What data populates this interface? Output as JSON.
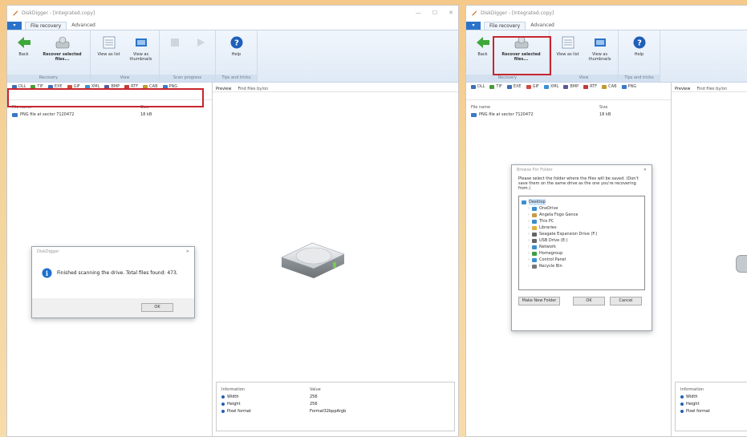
{
  "app": {
    "title": "DiskDigger - [Integrated.copy]",
    "file_menu_label": "",
    "tabs": [
      "File recovery",
      "Advanced"
    ],
    "window_controls": [
      "—",
      "☐",
      "✕"
    ]
  },
  "ribbon": {
    "back_label": "Back",
    "recover_label": "Recover selected files...",
    "view_list_label": "View as list",
    "view_thumbs_label": "View as thumbnails",
    "stop_label": "",
    "resume_label": "",
    "help_label": "Help",
    "groups": [
      "Recovery",
      "View",
      "Scan progress",
      "Tips and tricks"
    ]
  },
  "filters": [
    "DLL",
    "TIF",
    "EXE",
    "GIF",
    "XML",
    "BMP",
    "RTF",
    "CAB",
    "PNG"
  ],
  "filter_colors": [
    "#3c6fb5",
    "#4a9a3c",
    "#3c6fb5",
    "#d24a3a",
    "#3b8fd0",
    "#5a5a9a",
    "#c23a3a",
    "#c29a2a",
    "#3b78c8"
  ],
  "file_list": {
    "col_name": "File name",
    "col_size": "Size",
    "rows": [
      {
        "name": "PNG file at sector 7120472",
        "size": "18 kB"
      }
    ]
  },
  "preview_tabs": [
    "Preview",
    "Find files by/on"
  ],
  "info": {
    "col_info": "Information",
    "col_value": "Value",
    "rows": [
      {
        "k": "Width",
        "v": "256"
      },
      {
        "k": "Height",
        "v": "256"
      },
      {
        "k": "Pixel format",
        "v": "Format32bppArgb"
      }
    ]
  },
  "scan_dialog": {
    "title": "DiskDigger",
    "message": "Finished scanning the drive. Total files found: 473.",
    "ok_label": "OK"
  },
  "folder_dialog": {
    "title": "Browse For Folder",
    "message": "Please select the folder where the files will be saved. (Don't save them on the same drive as the one you're recovering from.)",
    "tree": [
      {
        "label": "Desktop",
        "icon": "desktop-icon",
        "color": "#3b8fd0",
        "indent": 0,
        "selected": true
      },
      {
        "label": "OneDrive",
        "icon": "cloud-icon",
        "color": "#3b8fd0",
        "indent": 1
      },
      {
        "label": "Angela Fogo Gence",
        "icon": "user-icon",
        "color": "#c89a4a",
        "indent": 1
      },
      {
        "label": "This PC",
        "icon": "computer-icon",
        "color": "#3b8fd0",
        "indent": 1
      },
      {
        "label": "Libraries",
        "icon": "folder-icon",
        "color": "#e0b040",
        "indent": 1
      },
      {
        "label": "Seagate Expansion Drive (F:)",
        "icon": "drive-icon",
        "color": "#666",
        "indent": 1
      },
      {
        "label": "USB Drive (E:)",
        "icon": "usb-icon",
        "color": "#666",
        "indent": 1
      },
      {
        "label": "Network",
        "icon": "network-icon",
        "color": "#3b8fd0",
        "indent": 1
      },
      {
        "label": "Homegroup",
        "icon": "homegroup-icon",
        "color": "#3aa040",
        "indent": 1
      },
      {
        "label": "Control Panel",
        "icon": "control-panel-icon",
        "color": "#3b8fd0",
        "indent": 1
      },
      {
        "label": "Recycle Bin",
        "icon": "recycle-bin-icon",
        "color": "#777",
        "indent": 1
      }
    ],
    "make_folder_label": "Make New Folder",
    "ok_label": "OK",
    "cancel_label": "Cancel"
  },
  "colors": {
    "accent": "#2b73c9",
    "highlight": "#c8262e",
    "ribbon_bg": "#dfeaf6"
  }
}
